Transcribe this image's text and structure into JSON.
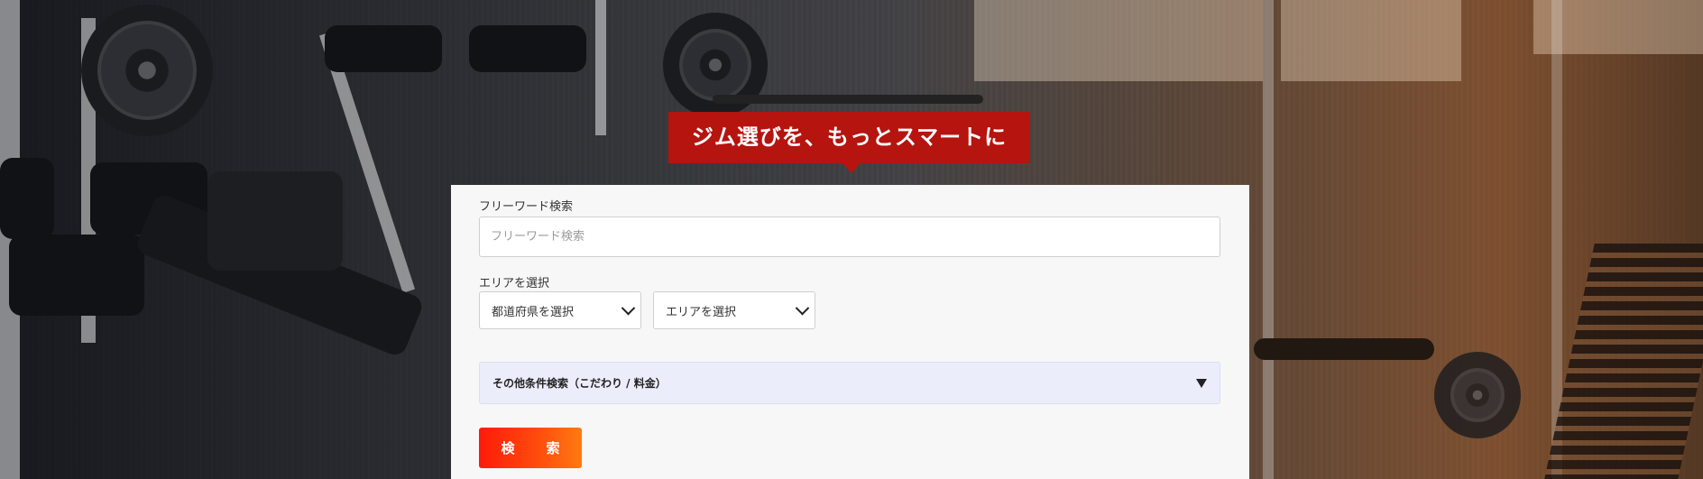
{
  "hero": {
    "tagline": "ジム選びを、もっとスマートに"
  },
  "search_form": {
    "freeword": {
      "label": "フリーワード検索",
      "placeholder": "フリーワード検索",
      "value": ""
    },
    "area": {
      "label": "エリアを選択",
      "prefecture_select": "都道府県を選択",
      "area_select": "エリアを選択"
    },
    "more_conditions": {
      "label": "その他条件検索（こだわり / 料金）",
      "icon": "triangle-down-icon"
    },
    "submit_label": "検　索"
  },
  "colors": {
    "tagline_bg": "#b5140f",
    "panel_bg": "#f7f7f7",
    "accordion_bg": "#ebedfb",
    "button_start": "#ff1a0a",
    "button_end": "#ff7a12"
  }
}
